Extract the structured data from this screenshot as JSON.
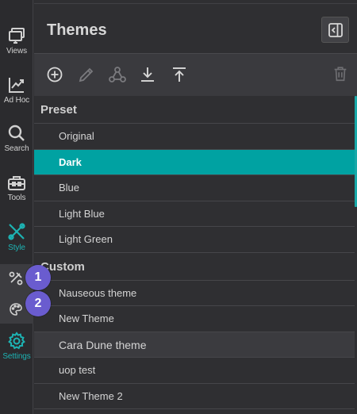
{
  "rail": {
    "items": [
      {
        "label": "Views",
        "icon": "views-icon"
      },
      {
        "label": "Ad Hoc",
        "icon": "adhoc-chart-icon"
      },
      {
        "label": "Search",
        "icon": "search-icon"
      },
      {
        "label": "Tools",
        "icon": "toolbox-icon"
      },
      {
        "label": "Style",
        "icon": "style-brush-icon"
      },
      {
        "label": "Settings",
        "icon": "gear-icon"
      }
    ],
    "sub_items": [
      {
        "icon": "style-link-icon"
      },
      {
        "icon": "palette-icon"
      }
    ],
    "badges": [
      "1",
      "2"
    ]
  },
  "panel": {
    "title": "Themes",
    "collapse_icon": "collapse-panel-icon"
  },
  "toolbar": {
    "tools": [
      "add-circle-icon",
      "edit-pencil-icon",
      "share-network-icon",
      "download-icon",
      "upload-icon",
      "trash-icon"
    ]
  },
  "groups": [
    {
      "label": "Preset",
      "items": [
        "Original",
        "Dark",
        "Blue",
        "Light Blue",
        "Light Green"
      ]
    },
    {
      "label": "Custom",
      "items": [
        "Nauseous theme",
        "New Theme",
        "Cara Dune theme",
        "uop test",
        "New Theme 2"
      ]
    }
  ],
  "selected_item": "Dark",
  "hovered_item": "Cara Dune theme",
  "colors": {
    "accent": "#00a2a2",
    "badge": "#6a5ccf",
    "background": "#2f2f32"
  }
}
